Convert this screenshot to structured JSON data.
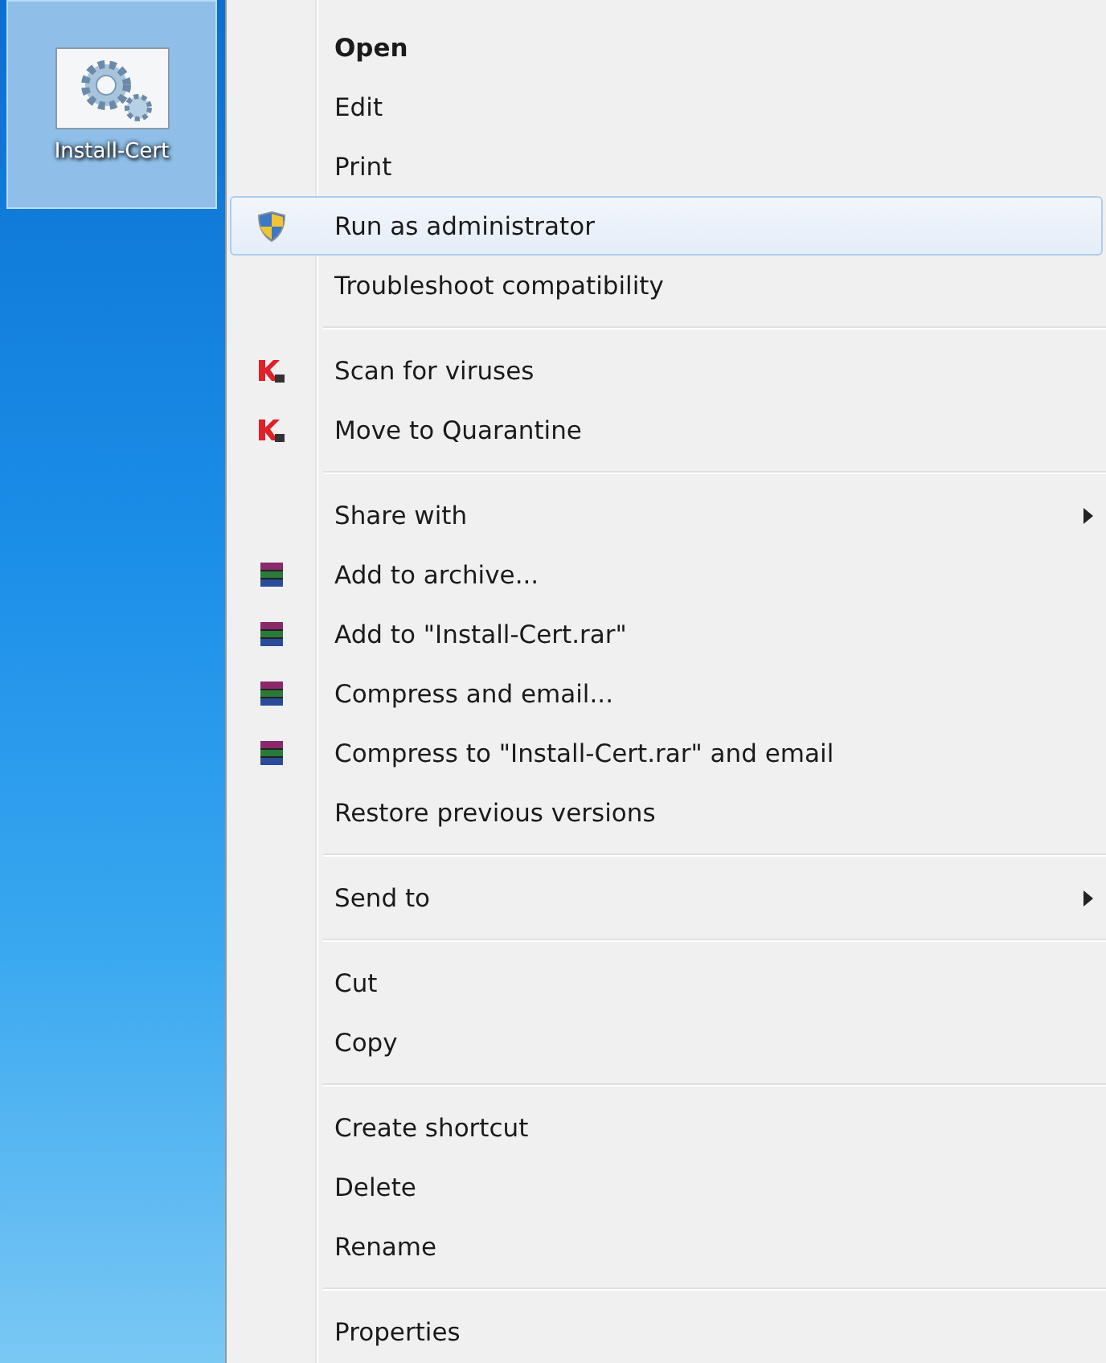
{
  "desktop_icon": {
    "label": "Install-Cert",
    "selected": true
  },
  "menu": {
    "groups": [
      [
        {
          "label": "Open",
          "default": true,
          "selected": false
        },
        {
          "label": "Edit",
          "default": false,
          "selected": false
        },
        {
          "label": "Print",
          "default": false,
          "selected": false
        },
        {
          "label": "Run as administrator",
          "default": false,
          "selected": true,
          "kind": "shield"
        },
        {
          "label": "Troubleshoot compatibility",
          "default": false,
          "selected": false
        }
      ],
      [
        {
          "label": "Scan for viruses",
          "default": false,
          "selected": false,
          "kind": "antivirus"
        },
        {
          "label": "Move to Quarantine",
          "default": false,
          "selected": false,
          "kind": "antivirus"
        }
      ],
      [
        {
          "label": "Share with",
          "default": false,
          "selected": false,
          "submenu": true
        },
        {
          "label": "Add to archive...",
          "default": false,
          "selected": false,
          "kind": "archive"
        },
        {
          "label": "Add to \"Install-Cert.rar\"",
          "default": false,
          "selected": false,
          "kind": "archive"
        },
        {
          "label": "Compress and email...",
          "default": false,
          "selected": false,
          "kind": "archive"
        },
        {
          "label": "Compress to \"Install-Cert.rar\" and email",
          "default": false,
          "selected": false,
          "kind": "archive"
        },
        {
          "label": "Restore previous versions",
          "default": false,
          "selected": false
        }
      ],
      [
        {
          "label": "Send to",
          "default": false,
          "selected": false,
          "submenu": true
        }
      ],
      [
        {
          "label": "Cut",
          "default": false,
          "selected": false
        },
        {
          "label": "Copy",
          "default": false,
          "selected": false
        }
      ],
      [
        {
          "label": "Create shortcut",
          "default": false,
          "selected": false
        },
        {
          "label": "Delete",
          "default": false,
          "selected": false
        },
        {
          "label": "Rename",
          "default": false,
          "selected": false
        }
      ],
      [
        {
          "label": "Properties",
          "default": false,
          "selected": false
        }
      ]
    ]
  }
}
